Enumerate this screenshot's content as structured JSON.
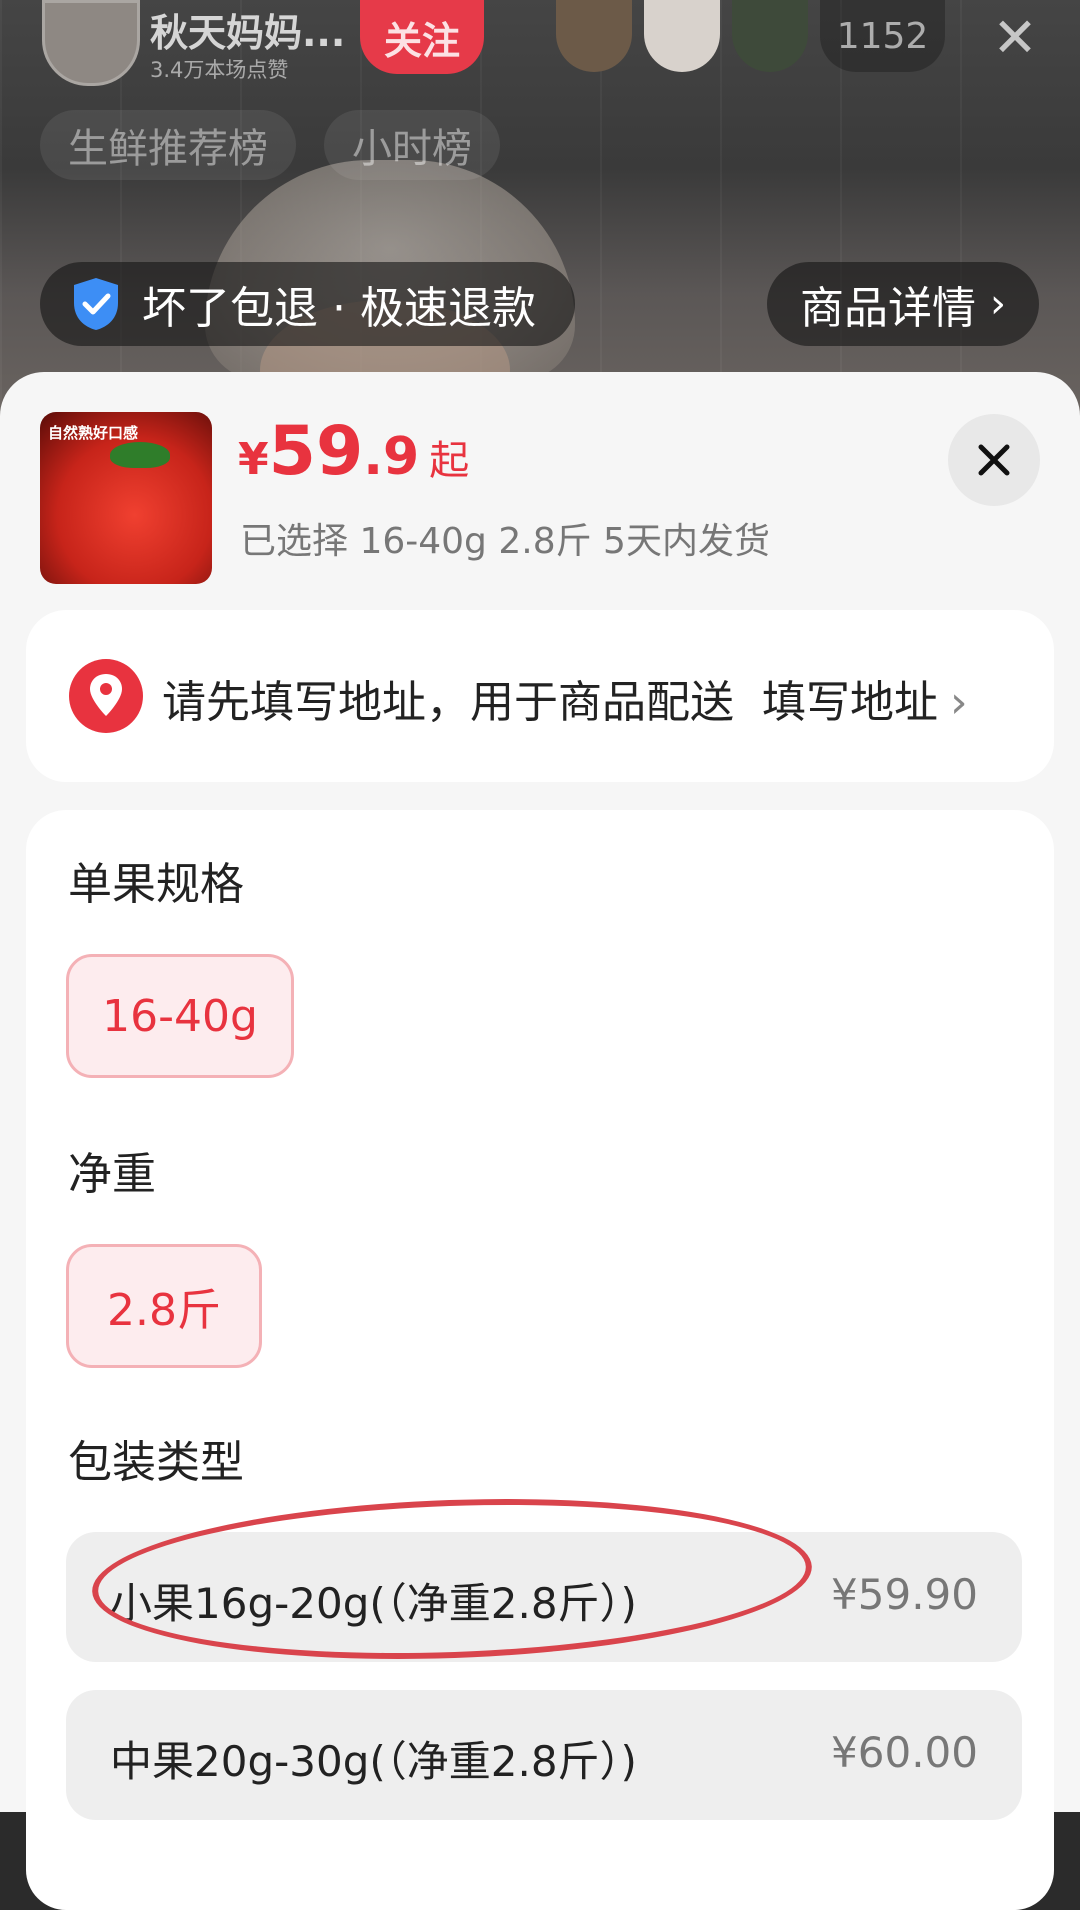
{
  "live": {
    "host_name": "秋天妈妈...",
    "host_likes": "3.4万本场点赞",
    "follow_label": "关注",
    "viewer_count": "1152",
    "close_label": "✕",
    "rank_tabs": [
      "生鲜推荐榜",
      "小时榜"
    ],
    "guarantee": "坏了包退 · 极速退款",
    "detail_label": "商品详情",
    "chevron": "›"
  },
  "product": {
    "thumb_caption": "自然熟好口感",
    "price_symbol": "¥",
    "price_int": "59",
    "price_dec": ".9",
    "price_suffix": "起",
    "selected_summary": "已选择 16-40g 2.8斤 5天内发货"
  },
  "address": {
    "prompt": "请先填写地址，用于商品配送",
    "action": "填写地址",
    "chevron": "›"
  },
  "specs": {
    "groups": [
      {
        "title": "单果规格",
        "options": [
          "16-40g"
        ]
      },
      {
        "title": "净重",
        "options": [
          "2.8斤"
        ]
      },
      {
        "title": "包装类型"
      }
    ],
    "packages": [
      {
        "name": "小果16g-20g(（净重2.8斤）)",
        "price": "¥59.90"
      },
      {
        "name": "中果20g-30g(（净重2.8斤）)",
        "price": "¥60.00"
      }
    ]
  },
  "colors": {
    "accent": "#e8333f",
    "sheet_bg": "#f6f6f6",
    "annotation": "#d9444c"
  },
  "icons": [
    "shield-check-icon",
    "close-icon",
    "location-pin-icon",
    "chevron-right-icon"
  ]
}
